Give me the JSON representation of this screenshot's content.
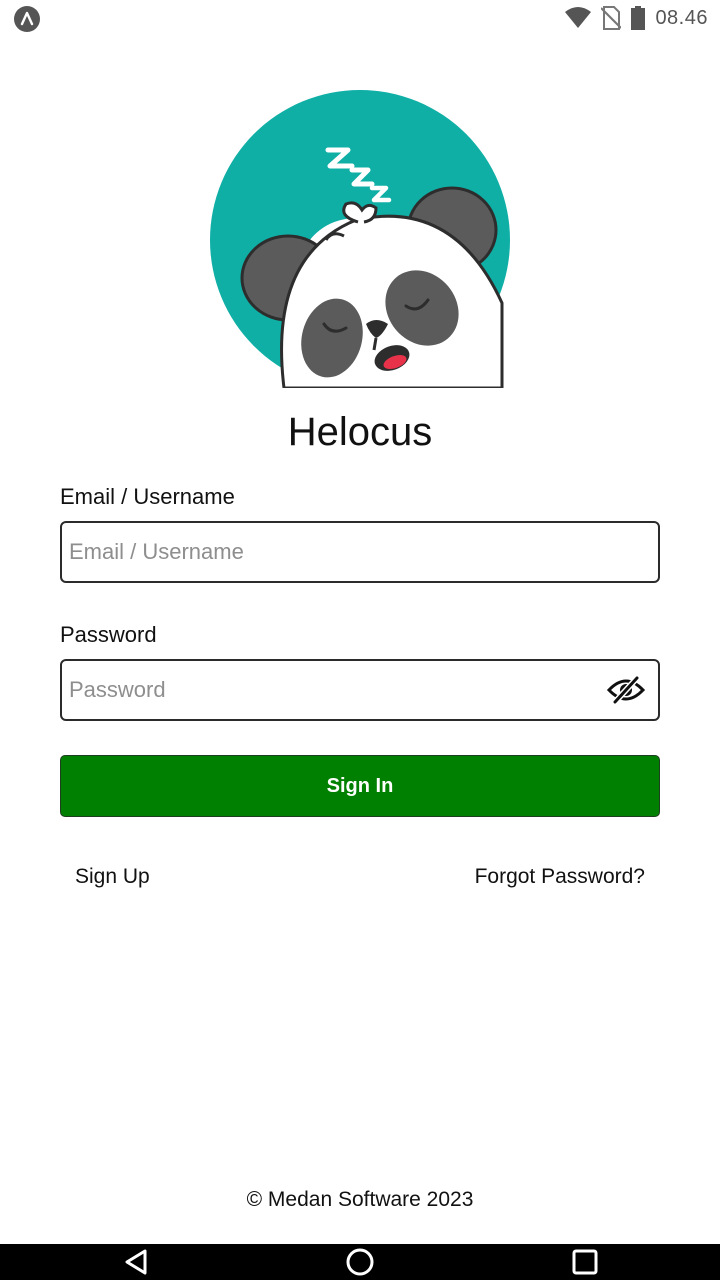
{
  "status_bar": {
    "time": "08.46",
    "icons": [
      "app-notification-icon",
      "wifi-icon",
      "no-sim-icon",
      "battery-icon"
    ]
  },
  "logo": {
    "icon": "sleeping-panda-logo",
    "background_color": "#0fafa6"
  },
  "app": {
    "title": "Helocus"
  },
  "login_form": {
    "email_label": "Email / Username",
    "email_placeholder": "Email / Username",
    "email_value": "",
    "password_label": "Password",
    "password_placeholder": "Password",
    "password_value": "",
    "toggle_visibility_icon": "eye-off-icon",
    "signin_label": "Sign In",
    "signin_color": "#008000"
  },
  "links": {
    "signup": "Sign Up",
    "forgot_password": "Forgot Password?"
  },
  "footer": {
    "copyright": "© Medan Software 2023"
  },
  "nav_bar": {
    "icons": [
      "back-icon",
      "home-icon",
      "recent-apps-icon"
    ]
  }
}
